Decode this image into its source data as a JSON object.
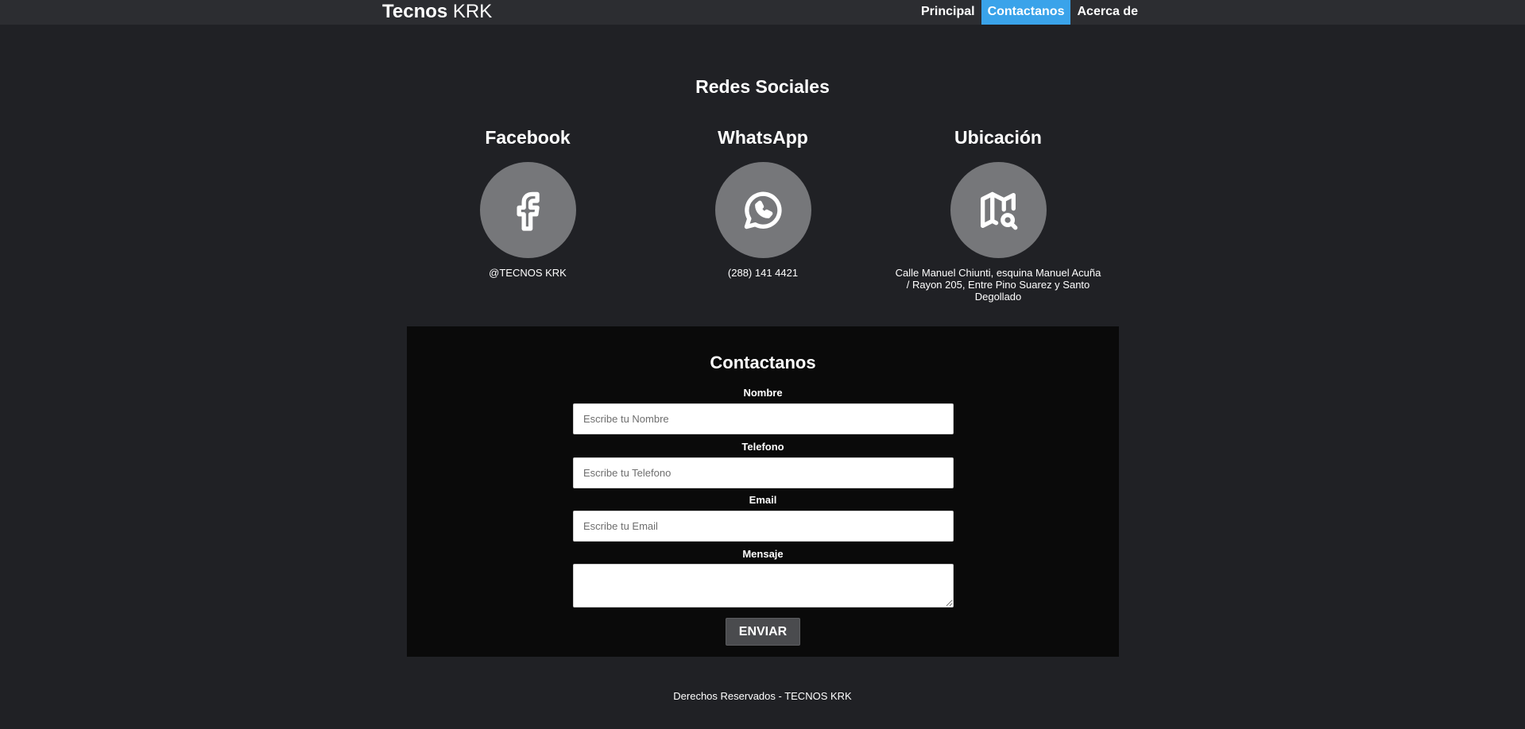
{
  "header": {
    "brand_bold": "Tecnos",
    "brand_light": "KRK",
    "nav": [
      {
        "label": "Principal",
        "active": false
      },
      {
        "label": "Contactanos",
        "active": true
      },
      {
        "label": "Acerca de",
        "active": false
      }
    ]
  },
  "social": {
    "title": "Redes Sociales",
    "items": [
      {
        "title": "Facebook",
        "icon": "facebook-icon",
        "info": "@TECNOS KRK"
      },
      {
        "title": "WhatsApp",
        "icon": "whatsapp-icon",
        "info": "(288) 141 4421"
      },
      {
        "title": "Ubicación",
        "icon": "map-search-icon",
        "info": "Calle Manuel Chiunti, esquina Manuel Acuña / Rayon 205, Entre Pino Suarez y Santo Degollado"
      }
    ]
  },
  "contact": {
    "title": "Contactanos",
    "fields": [
      {
        "label": "Nombre",
        "placeholder": "Escribe tu Nombre"
      },
      {
        "label": "Telefono",
        "placeholder": "Escribe tu Telefono"
      },
      {
        "label": "Email",
        "placeholder": "Escribe tu Email"
      },
      {
        "label": "Mensaje",
        "placeholder": ""
      }
    ],
    "submit_label": "ENVIAR"
  },
  "footer": {
    "text": "Derechos Reservados - TECNOS KRK"
  },
  "colors": {
    "background": "#202125",
    "topbar": "#2c2d31",
    "accent": "#3aa3ea",
    "panel": "#0a0a0a",
    "icon_circle": "#76777a"
  }
}
